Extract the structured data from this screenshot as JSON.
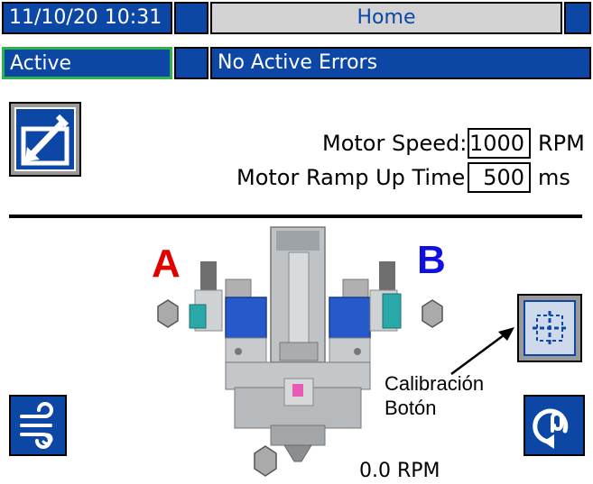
{
  "header": {
    "datetime": "11/10/20 10:31",
    "screen_title": "Home",
    "status": "Active",
    "errors": "No Active Errors"
  },
  "settings": {
    "motor_speed_label": "Motor Speed:",
    "motor_speed_value": "1000",
    "motor_speed_unit": "RPM",
    "ramp_label": "Motor Ramp Up Time:",
    "ramp_value": "500",
    "ramp_unit": "ms"
  },
  "pump": {
    "side_a": "A",
    "side_b": "B",
    "rpm_readout": "0.0 RPM"
  },
  "annotation": {
    "line1": "Calibración",
    "line2": "Botón"
  },
  "colors": {
    "accent_blue": "#0d47a6",
    "label_a": "#e00000",
    "label_b": "#1010e0",
    "status_border": "#2fb34a"
  },
  "icons": {
    "edit": "edit-icon",
    "calibrate": "calibration-icon",
    "air": "air-purge-icon",
    "recirculate": "recirculate-icon"
  }
}
